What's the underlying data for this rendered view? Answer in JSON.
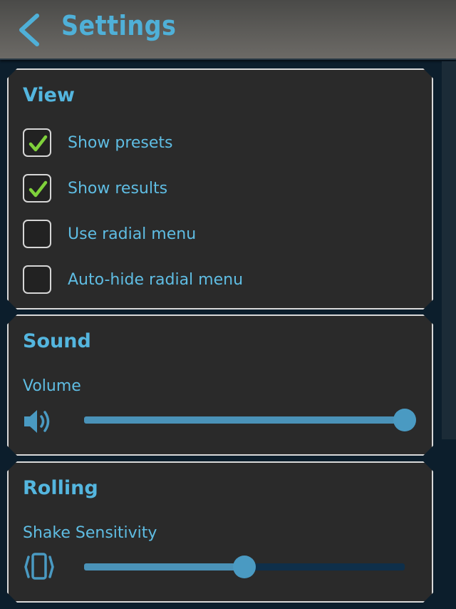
{
  "header": {
    "title": "Settings"
  },
  "view": {
    "title": "View",
    "options": [
      {
        "label": "Show presets",
        "checked": true
      },
      {
        "label": "Show results",
        "checked": true
      },
      {
        "label": "Use radial menu",
        "checked": false
      },
      {
        "label": "Auto-hide radial menu",
        "checked": false
      }
    ]
  },
  "sound": {
    "title": "Sound",
    "volume_label": "Volume",
    "volume_value": 1.0,
    "icon": "speaker-icon"
  },
  "rolling": {
    "title": "Rolling",
    "shake_label": "Shake Sensitivity",
    "shake_value": 0.5,
    "icon": "shake-phone-icon"
  },
  "colors": {
    "accent": "#54b6df",
    "check": "#7fd13b",
    "panel_bg": "#2a2a2a",
    "slider_fill": "#4a92b8",
    "slider_track": "#0e2f4a"
  }
}
